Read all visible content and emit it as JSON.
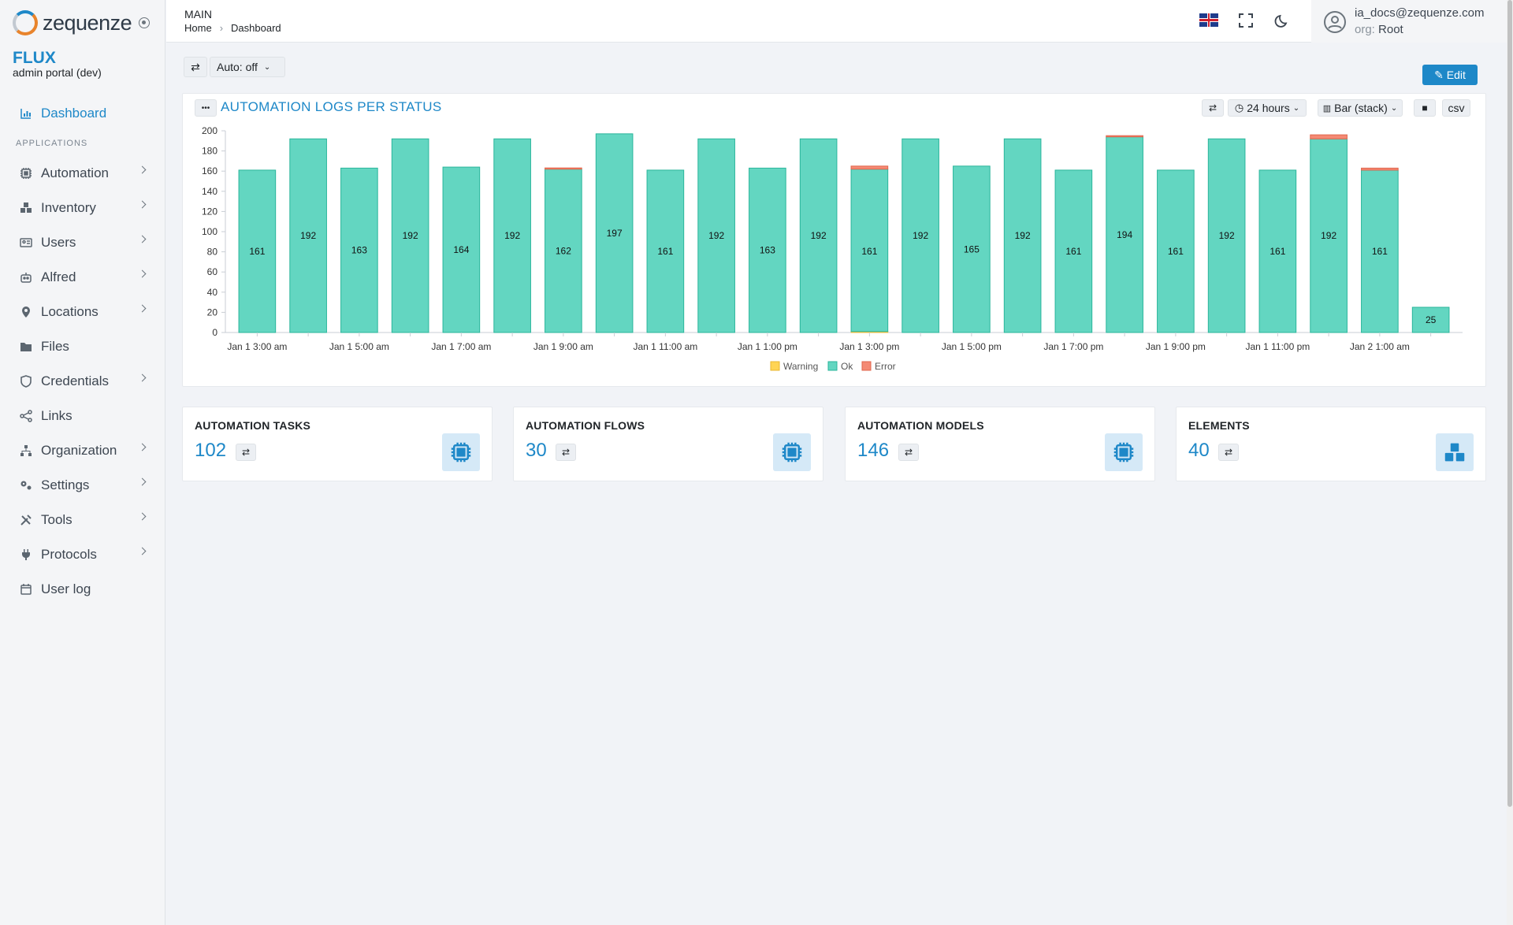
{
  "brand": {
    "name": "zequenze",
    "product": "FLUX",
    "subtitle": "admin portal (dev)"
  },
  "sidebar": {
    "dashboard": "Dashboard",
    "section_label": "APPLICATIONS",
    "items": [
      {
        "label": "Automation",
        "icon": "cpu-icon"
      },
      {
        "label": "Inventory",
        "icon": "boxes-icon"
      },
      {
        "label": "Users",
        "icon": "id-card-icon"
      },
      {
        "label": "Alfred",
        "icon": "robot-icon"
      },
      {
        "label": "Locations",
        "icon": "map-pin-icon"
      },
      {
        "label": "Files",
        "icon": "folder-icon"
      },
      {
        "label": "Credentials",
        "icon": "shield-icon"
      },
      {
        "label": "Links",
        "icon": "share-icon"
      },
      {
        "label": "Organization",
        "icon": "sitemap-icon"
      },
      {
        "label": "Settings",
        "icon": "gears-icon"
      },
      {
        "label": "Tools",
        "icon": "tools-icon"
      },
      {
        "label": "Protocols",
        "icon": "plug-icon"
      },
      {
        "label": "User log",
        "icon": "calendar-icon"
      }
    ]
  },
  "header": {
    "section": "MAIN",
    "breadcrumb": [
      "Home",
      "Dashboard"
    ],
    "user_email": "ia_docs@zequenze.com",
    "org_label": "org:",
    "org_value": "Root"
  },
  "toolbar": {
    "auto_label": "Auto: off",
    "edit_label": "Edit"
  },
  "chart_panel": {
    "title": "AUTOMATION LOGS PER STATUS",
    "range_label": "24 hours",
    "type_label": "Bar (stack)",
    "csv_label": "csv",
    "menu_label": "•••"
  },
  "chart_data": {
    "type": "bar",
    "stacked": true,
    "ylim": [
      0,
      200
    ],
    "yticks": [
      0,
      20,
      40,
      60,
      80,
      100,
      120,
      140,
      160,
      180,
      200
    ],
    "x_tick_labels": [
      "Jan 1 3:00 am",
      "Jan 1 5:00 am",
      "Jan 1 7:00 am",
      "Jan 1 9:00 am",
      "Jan 1 11:00 am",
      "Jan 1 1:00 pm",
      "Jan 1 3:00 pm",
      "Jan 1 5:00 pm",
      "Jan 1 7:00 pm",
      "Jan 1 9:00 pm",
      "Jan 1 11:00 pm",
      "Jan 2 1:00 am"
    ],
    "x": [
      "Jan 1 3:00 am",
      "Jan 1 4:00 am",
      "Jan 1 5:00 am",
      "Jan 1 6:00 am",
      "Jan 1 7:00 am",
      "Jan 1 8:00 am",
      "Jan 1 9:00 am",
      "Jan 1 10:00 am",
      "Jan 1 11:00 am",
      "Jan 1 12:00 pm",
      "Jan 1 1:00 pm",
      "Jan 1 2:00 pm",
      "Jan 1 3:00 pm",
      "Jan 1 4:00 pm",
      "Jan 1 5:00 pm",
      "Jan 1 6:00 pm",
      "Jan 1 7:00 pm",
      "Jan 1 8:00 pm",
      "Jan 1 9:00 pm",
      "Jan 1 10:00 pm",
      "Jan 1 11:00 pm",
      "Jan 2 12:00 am",
      "Jan 2 1:00 am",
      "Jan 2 2:00 am"
    ],
    "series": [
      {
        "name": "Warning",
        "color": "#ffd454",
        "values": [
          0,
          0,
          0,
          0,
          0,
          0,
          0,
          0,
          0,
          0,
          0,
          0,
          1,
          0,
          0,
          0,
          0,
          0,
          0,
          0,
          0,
          0,
          0,
          0
        ]
      },
      {
        "name": "Ok",
        "color": "#63d6c1",
        "values": [
          161,
          192,
          163,
          192,
          164,
          192,
          162,
          197,
          161,
          192,
          163,
          192,
          161,
          192,
          165,
          192,
          161,
          194,
          161,
          192,
          161,
          192,
          161,
          25
        ]
      },
      {
        "name": "Error",
        "color": "#f48a74",
        "values": [
          0,
          0,
          0,
          0,
          0,
          0,
          1,
          0,
          0,
          0,
          0,
          0,
          3,
          0,
          0,
          0,
          0,
          1,
          0,
          0,
          0,
          4,
          2,
          0
        ]
      }
    ],
    "legend_position": "bottom",
    "grid": false
  },
  "cards": [
    {
      "title": "AUTOMATION TASKS",
      "value": "102",
      "icon": "cpu-icon"
    },
    {
      "title": "AUTOMATION FLOWS",
      "value": "30",
      "icon": "cpu-icon"
    },
    {
      "title": "AUTOMATION MODELS",
      "value": "146",
      "icon": "cpu-icon"
    },
    {
      "title": "ELEMENTS",
      "value": "40",
      "icon": "boxes-icon"
    }
  ]
}
